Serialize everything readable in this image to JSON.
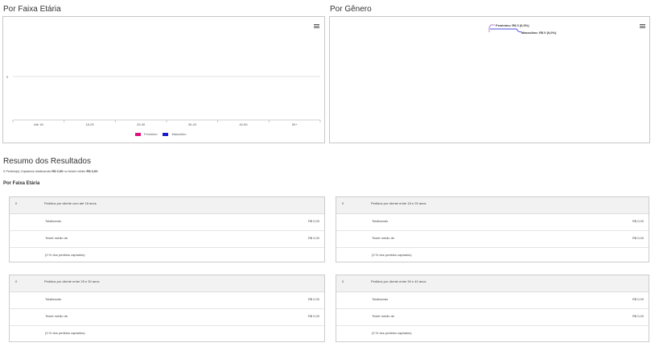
{
  "age_section": {
    "title": "Por Faixa Etária"
  },
  "gender_section": {
    "title": "Por Gênero"
  },
  "age_chart": {
    "y_tick": "0",
    "categories": [
      "Até 18",
      "18-25",
      "25-30",
      "30-40",
      "40-50",
      "50+"
    ],
    "legend": [
      {
        "name": "Feminino",
        "color": "#e0117f"
      },
      {
        "name": "Masculino",
        "color": "#1a1acc"
      }
    ]
  },
  "gender_chart": {
    "labels": [
      {
        "text": "Feminino: R$ 0 (0,0%)",
        "color": "#9b59b6"
      },
      {
        "text": "Masculino: R$ 0 (0,0%)",
        "color": "#1a1acc"
      }
    ]
  },
  "chart_data": [
    {
      "type": "bar",
      "categories": [
        "Até 18",
        "18-25",
        "25-30",
        "30-40",
        "40-50",
        "50+"
      ],
      "series": [
        {
          "name": "Feminino",
          "values": [
            0,
            0,
            0,
            0,
            0,
            0
          ]
        },
        {
          "name": "Masculino",
          "values": [
            0,
            0,
            0,
            0,
            0,
            0
          ]
        }
      ],
      "yticks": [
        "0"
      ],
      "legend_position": "bottom-center"
    },
    {
      "type": "pie",
      "labels": [
        "Feminino",
        "Masculino"
      ],
      "values": [
        0,
        0
      ],
      "data_labels": [
        "Feminino: R$ 0 (0,0%)",
        "Masculino: R$ 0 (0,0%)"
      ]
    }
  ],
  "summary": {
    "title": "Resumo dos Resultados",
    "line_prefix": "0 Pedido(s) Captados totalizando",
    "line_total": "R$ 0,00",
    "line_middle": "no ticket médio",
    "line_ticket": "R$ 0,00",
    "age_heading": "Por Faixa Etária"
  },
  "cards": [
    {
      "count": "0",
      "header": "Pedidos por cliente com até 18 anos",
      "total_label": "Totalizando",
      "total_value": "R$ 0,00",
      "ticket_label": "Ticket médio de",
      "ticket_value": "R$ 0,00",
      "pct": "(0 % dos pedidos captados)"
    },
    {
      "count": "0",
      "header": "Pedidos por cliente entre 18 e 25 anos",
      "total_label": "Totalizando",
      "total_value": "R$ 0,00",
      "ticket_label": "Ticket médio de",
      "ticket_value": "R$ 0,00",
      "pct": "(0 % dos pedidos captados)"
    },
    {
      "count": "0",
      "header": "Pedidos por cliente entre 25 e 30 anos",
      "total_label": "Totalizando",
      "total_value": "R$ 0,00",
      "ticket_label": "Ticket médio de",
      "ticket_value": "R$ 0,00",
      "pct": "(0 % dos pedidos captados)"
    },
    {
      "count": "0",
      "header": "Pedidos por cliente entre 30 e 40 anos",
      "total_label": "Totalizando",
      "total_value": "R$ 0,00",
      "ticket_label": "Ticket médio de",
      "ticket_value": "R$ 0,00",
      "pct": "(0 % dos pedidos captados)"
    }
  ]
}
